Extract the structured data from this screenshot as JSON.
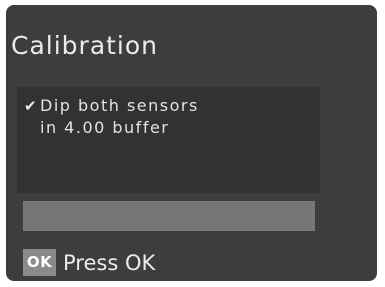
{
  "screen": {
    "title": "Calibration"
  },
  "instruction": {
    "check_icon": "check-icon",
    "check_glyph": "✔",
    "line1": "Dip both sensors",
    "line2": "in 4.00 buffer"
  },
  "progress": {
    "fraction": 0
  },
  "footer": {
    "ok_badge": "OK",
    "prompt": "Press OK"
  },
  "colors": {
    "screen_background": "#3d3d3d",
    "instruction_box": "#323232",
    "progress_bar": "#777777",
    "ok_badge": "#8a8a8a",
    "text": "#e6e6e6"
  }
}
